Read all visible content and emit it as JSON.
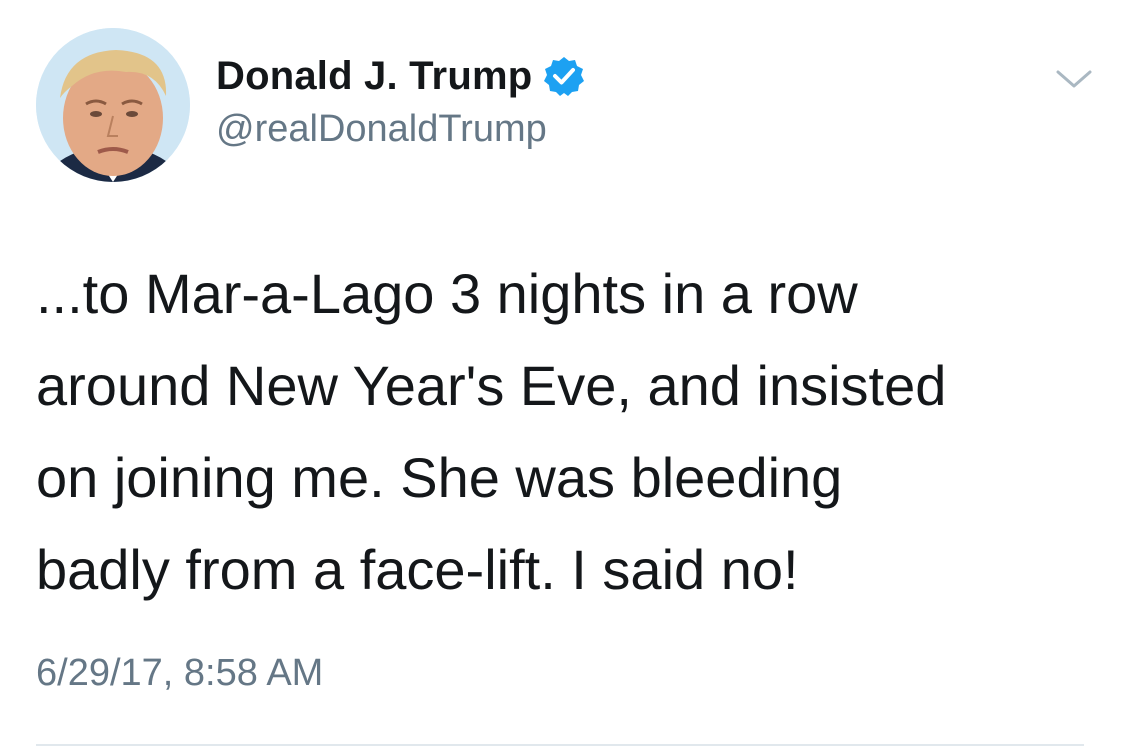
{
  "author": {
    "display_name": "Donald J. Trump",
    "handle": "@realDonaldTrump",
    "verified": true,
    "avatar": "profile-photo"
  },
  "tweet": {
    "text_lines": [
      "...to Mar-a-Lago 3 nights in a row",
      "around New Year's Eve, and insisted",
      "on joining me. She was bleeding",
      "badly from a face-lift. I said no!"
    ],
    "timestamp": "6/29/17, 8:58 AM"
  },
  "icons": {
    "verified": "verified-badge-icon",
    "menu": "chevron-down-icon"
  },
  "colors": {
    "primary_text": "#14171a",
    "secondary_text": "#657786",
    "verified_blue": "#1da1f2",
    "divider": "#e1e8ed"
  }
}
